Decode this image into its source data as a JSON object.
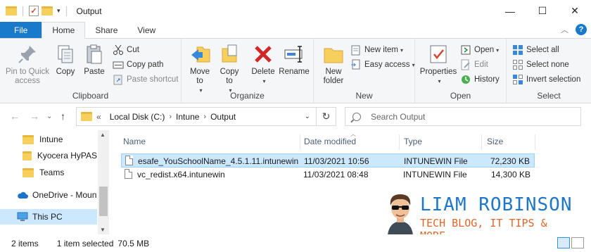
{
  "window": {
    "title": "Output",
    "controls": {
      "minimize": "—",
      "maximize": "☐",
      "close": "✕"
    }
  },
  "ribbon_tabs": [
    "File",
    "Home",
    "Share",
    "View"
  ],
  "ribbon": {
    "clipboard": {
      "label": "Clipboard",
      "pin": "Pin to Quick access",
      "copy": "Copy",
      "paste": "Paste",
      "cut": "Cut",
      "copy_path": "Copy path",
      "paste_shortcut": "Paste shortcut"
    },
    "organize": {
      "label": "Organize",
      "move_to": "Move to",
      "copy_to": "Copy to",
      "delete": "Delete",
      "rename": "Rename"
    },
    "new": {
      "label": "New",
      "new_folder": "New folder",
      "new_item": "New item",
      "easy_access": "Easy access"
    },
    "open": {
      "label": "Open",
      "properties": "Properties",
      "open": "Open",
      "edit": "Edit",
      "history": "History"
    },
    "select": {
      "label": "Select",
      "select_all": "Select all",
      "select_none": "Select none",
      "invert": "Invert selection"
    }
  },
  "address": {
    "overflow": "«",
    "crumbs": [
      "Local Disk (C:)",
      "Intune",
      "Output"
    ],
    "search_placeholder": "Search Output"
  },
  "nav_pane": [
    {
      "label": "Intune",
      "type": "folder"
    },
    {
      "label": "Kyocera HyPAS",
      "type": "folder"
    },
    {
      "label": "Teams",
      "type": "folder"
    },
    {
      "label": "OneDrive - Mount",
      "type": "onedrive"
    },
    {
      "label": "This PC",
      "type": "pc"
    }
  ],
  "columns": {
    "name": "Name",
    "date": "Date modified",
    "type": "Type",
    "size": "Size"
  },
  "files": [
    {
      "name": "esafe_YouSchoolName_4.5.1.11.intunewin",
      "date": "11/03/2021 10:56",
      "type": "INTUNEWIN File",
      "size": "72,230 KB",
      "selected": true
    },
    {
      "name": "vc_redist.x64.intunewin",
      "date": "11/03/2021 08:48",
      "type": "INTUNEWIN File",
      "size": "14,300 KB",
      "selected": false
    }
  ],
  "status": {
    "items": "2 items",
    "selected": "1 item selected",
    "size": "70.5 MB"
  },
  "brand": {
    "name": "LIAM ROBINSON",
    "tagline": "TECH BLOG, IT TIPS & MORE"
  },
  "colors": {
    "accent": "#1979ca",
    "selection": "#cce8ff",
    "brand_blue": "#1f77c9",
    "brand_orange": "#e2662a"
  }
}
